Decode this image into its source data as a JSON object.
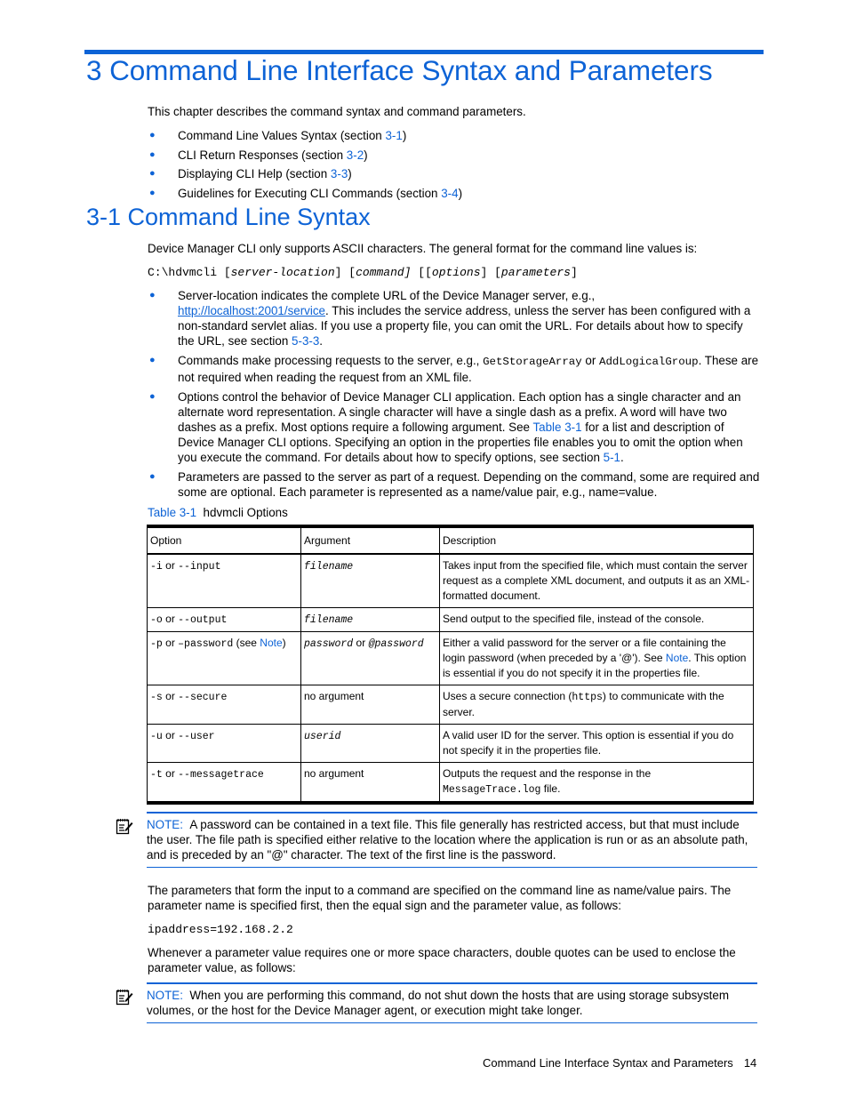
{
  "chapter": {
    "title": "3 Command Line Interface Syntax and Parameters",
    "intro": "This chapter describes the command syntax and command parameters.",
    "toc": [
      {
        "text": "Command Line Values Syntax (section ",
        "ref": "3-1",
        "after": ")"
      },
      {
        "text": "CLI Return Responses (section ",
        "ref": "3-2",
        "after": ")"
      },
      {
        "text": "Displaying CLI Help (section ",
        "ref": "3-3",
        "after": ")"
      },
      {
        "text": "Guidelines for Executing CLI Commands (section ",
        "ref": "3-4",
        "after": ")"
      }
    ]
  },
  "section": {
    "title": "3-1 Command Line Syntax",
    "intro": "Device Manager CLI only supports ASCII characters. The general format for the command line values is:",
    "syntax": {
      "prefix": "C:\\hdvmcli [",
      "server_location": "server-location",
      "sep1": "] [",
      "command": "command]",
      "sep2": " [",
      "options": "options",
      "sep3": "] [",
      "parameters": "parameters",
      "suffix": "]"
    },
    "bullets": {
      "server_location": {
        "a": "Server-location indicates the complete URL of the Device Manager server, e.g.,",
        "url": "http://localhost:2001/service",
        "b": ". This includes the service address, unless the server has been configured with a non-standard servlet alias. If you use a property file, you can omit the URL. For details about how to specify the URL, see section ",
        "ref": "5-3-3",
        "c": "."
      },
      "commands": {
        "a": "Commands make processing requests to the server, e.g., ",
        "code1": "GetStorageArray",
        "b": " or ",
        "code2": "AddLogicalGroup",
        "c": ". These are not required when reading the request from an XML file."
      },
      "options": {
        "a": "Options control the behavior of Device Manager CLI application. Each option has a single character and an alternate word representation. A single character will have a single dash as a prefix. A word will have two dashes as a prefix. Most options require a following argument. See ",
        "ref1": "Table 3-1",
        "b": " for a list and description of Device Manager CLI options. Specifying an option in the properties file enables you to omit the option when you execute the command. For details about how to specify options, see section ",
        "ref2": "5-1",
        "c": "."
      },
      "parameters": {
        "a": "Parameters are passed to the server as part of a request. Depending on the command, some are required and some are optional. Each parameter is represented as a name/value pair, e.g., name=value."
      }
    }
  },
  "table": {
    "caption_ref": "Table 3-1",
    "caption_text": "hdvmcli Options",
    "headers": [
      "Option",
      "Argument",
      "Description"
    ],
    "rows": [
      {
        "short": "-i",
        "or": " or ",
        "long": "--input",
        "see": "",
        "see_ref": "",
        "see_end": "",
        "arg_a": "filename",
        "arg_or": "",
        "arg_b": "",
        "arg_plain": "",
        "desc_a": "Takes input from the specified file, which must contain the server request as a complete XML document, and outputs it as an XML-formatted document.",
        "desc_code": "",
        "desc_b": "",
        "desc_ref": "",
        "desc_c": ""
      },
      {
        "short": "-o",
        "or": " or ",
        "long": "--output",
        "see": "",
        "see_ref": "",
        "see_end": "",
        "arg_a": "filename",
        "arg_or": "",
        "arg_b": "",
        "arg_plain": "",
        "desc_a": "Send output to the specified file, instead of the console.",
        "desc_code": "",
        "desc_b": "",
        "desc_ref": "",
        "desc_c": ""
      },
      {
        "short": "-p",
        "or": " or ",
        "long": "–password",
        "see": " (see ",
        "see_ref": "Note",
        "see_end": ")",
        "arg_a": "password",
        "arg_or": " or ",
        "arg_b": "@password",
        "arg_plain": "",
        "desc_a": "Either a valid password for the server or a file containing the login password (when preceded by a '@'). See ",
        "desc_code": "",
        "desc_b": "",
        "desc_ref": "Note",
        "desc_c": ". This option is essential if you do not specify it in the properties file."
      },
      {
        "short": "-s",
        "or": " or ",
        "long": "--secure",
        "see": "",
        "see_ref": "",
        "see_end": "",
        "arg_a": "",
        "arg_or": "",
        "arg_b": "",
        "arg_plain": "no argument",
        "desc_a": "Uses a secure connection (",
        "desc_code": "https",
        "desc_b": ") to communicate with the server.",
        "desc_ref": "",
        "desc_c": ""
      },
      {
        "short": "-u",
        "or": " or ",
        "long": "--user",
        "see": "",
        "see_ref": "",
        "see_end": "",
        "arg_a": "userid",
        "arg_or": "",
        "arg_b": "",
        "arg_plain": "",
        "desc_a": "A valid user ID for the server. This option is essential if you do not specify it in the properties file.",
        "desc_code": "",
        "desc_b": "",
        "desc_ref": "",
        "desc_c": ""
      },
      {
        "short": "-t",
        "or": " or ",
        "long": "--messagetrace",
        "see": "",
        "see_ref": "",
        "see_end": "",
        "arg_a": "",
        "arg_or": "",
        "arg_b": "",
        "arg_plain": "no argument",
        "desc_a": "Outputs the request and the response in the ",
        "desc_code": "MessageTrace.log",
        "desc_b": " file.",
        "desc_ref": "",
        "desc_c": ""
      }
    ]
  },
  "note1": {
    "label": "NOTE:",
    "text": "A password can be contained in a text file. This file generally has restricted access, but that must include the user. The file path is specified either relative to the location where the application is run or as an absolute path, and is preceded by an \"@\" character. The text of the first line is the password.",
    "icon": "note-icon"
  },
  "body": {
    "params_para": "The parameters that form the input to a command are specified on the command line as name/value pairs. The parameter name is specified first, then the equal sign and the parameter value, as follows:",
    "params_example": "ipaddress=192.168.2.2",
    "quotes_para": "Whenever a parameter value requires one or more space characters, double quotes can be used to enclose the parameter value, as follows:"
  },
  "note2": {
    "label": "NOTE:",
    "text": "When you are performing this command, do not shut down the hosts that are using storage subsystem volumes, or the host for the Device Manager agent, or execution might take longer.",
    "icon": "note-icon"
  },
  "footer": {
    "title": "Command Line Interface Syntax and Parameters",
    "page": "14"
  },
  "colors": {
    "accent": "#0d63d6",
    "text": "#000000"
  }
}
